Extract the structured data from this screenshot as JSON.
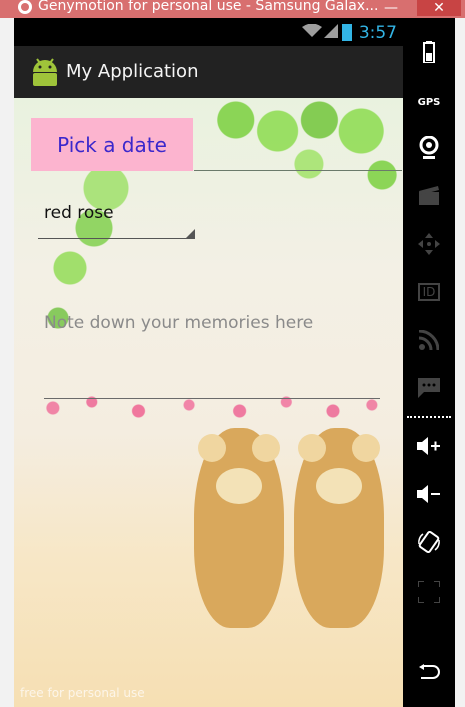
{
  "window": {
    "title": "Genymotion for personal use - Samsung Galax...",
    "min_label": "—",
    "close_label": "✕"
  },
  "statusbar": {
    "time": "3:57"
  },
  "actionbar": {
    "app_title": "My Application"
  },
  "form": {
    "pick_date_label": "Pick a date",
    "spinner_value": "red rose",
    "memory_placeholder": "Note down your memories here"
  },
  "watermark": "free for personal use",
  "sidebar": {
    "gps_label": "GPS",
    "id_label": "ID",
    "items": [
      "battery-icon",
      "gps-icon",
      "camera-icon",
      "clapper-icon",
      "dpad-icon",
      "id-icon",
      "rss-icon",
      "chat-icon",
      "volume-up-icon",
      "volume-down-icon",
      "rotate-icon",
      "scale-icon",
      "back-icon"
    ]
  },
  "colors": {
    "window_frame": "#e47d7d",
    "status_accent": "#33b5e5",
    "button_bg": "#fcb4cf",
    "button_text": "#3b28cc"
  }
}
